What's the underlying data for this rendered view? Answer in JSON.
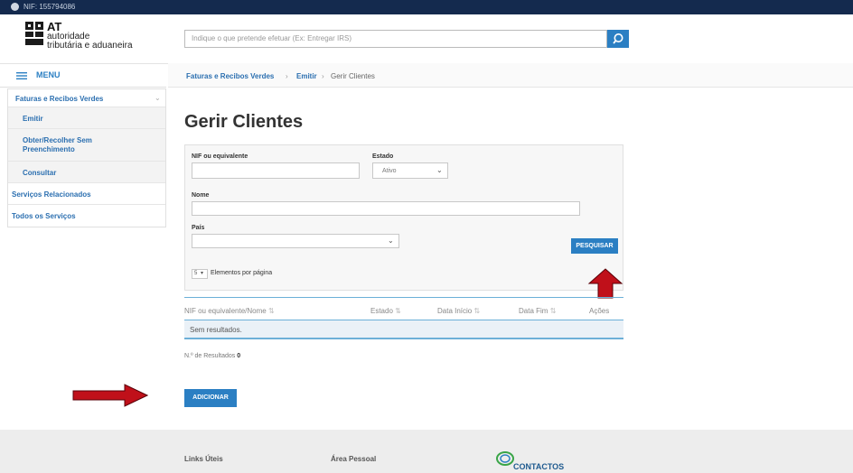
{
  "topbar": {
    "nif_text": "NIF: 155794086"
  },
  "logo": {
    "abbr": "AT",
    "line1": "autoridade",
    "line2": "tributária e aduaneira"
  },
  "search": {
    "placeholder": "Indique o que pretende efetuar (Ex: Entregar IRS)",
    "icon": "search-icon"
  },
  "menu": {
    "label": "MENU",
    "icon": "hamburger-icon"
  },
  "sidebar": {
    "items": [
      {
        "label": "Faturas e Recibos Verdes",
        "expanded": true
      },
      {
        "label": "Emitir"
      },
      {
        "label": "Obter/Recolher Sem Preenchimento"
      },
      {
        "label": "Consultar"
      },
      {
        "label": "Serviços Relacionados"
      },
      {
        "label": "Todos os Serviços"
      }
    ]
  },
  "breadcrumb": {
    "items": [
      "Faturas e Recibos Verdes",
      "Emitir",
      "Gerir Clientes"
    ],
    "separator": "›"
  },
  "page": {
    "title": "Gerir Clientes"
  },
  "filters": {
    "nif_label": "NIF ou equivalente",
    "nif_value": "",
    "estado_label": "Estado",
    "estado_value": "Ativo",
    "nome_label": "Nome",
    "nome_value": "",
    "pais_label": "País",
    "pais_value": "",
    "search_button": "PESQUISAR",
    "page_size": "5",
    "page_size_label": "Elementos por página"
  },
  "table": {
    "columns": [
      "NIF ou equivalente/Nome",
      "Estado",
      "Data Início",
      "Data Fim",
      "Ações"
    ],
    "empty_text": "Sem resultados.",
    "count_label": "N.º de Resultados",
    "count_value": "0"
  },
  "actions": {
    "add_button": "ADICIONAR"
  },
  "footer": {
    "col1": "Links Úteis",
    "col2": "Área Pessoal",
    "contact": "CONTACTOS"
  },
  "colors": {
    "accent": "#2b7fc3",
    "topbar": "#142a4e",
    "arrow": "#c0101a"
  }
}
